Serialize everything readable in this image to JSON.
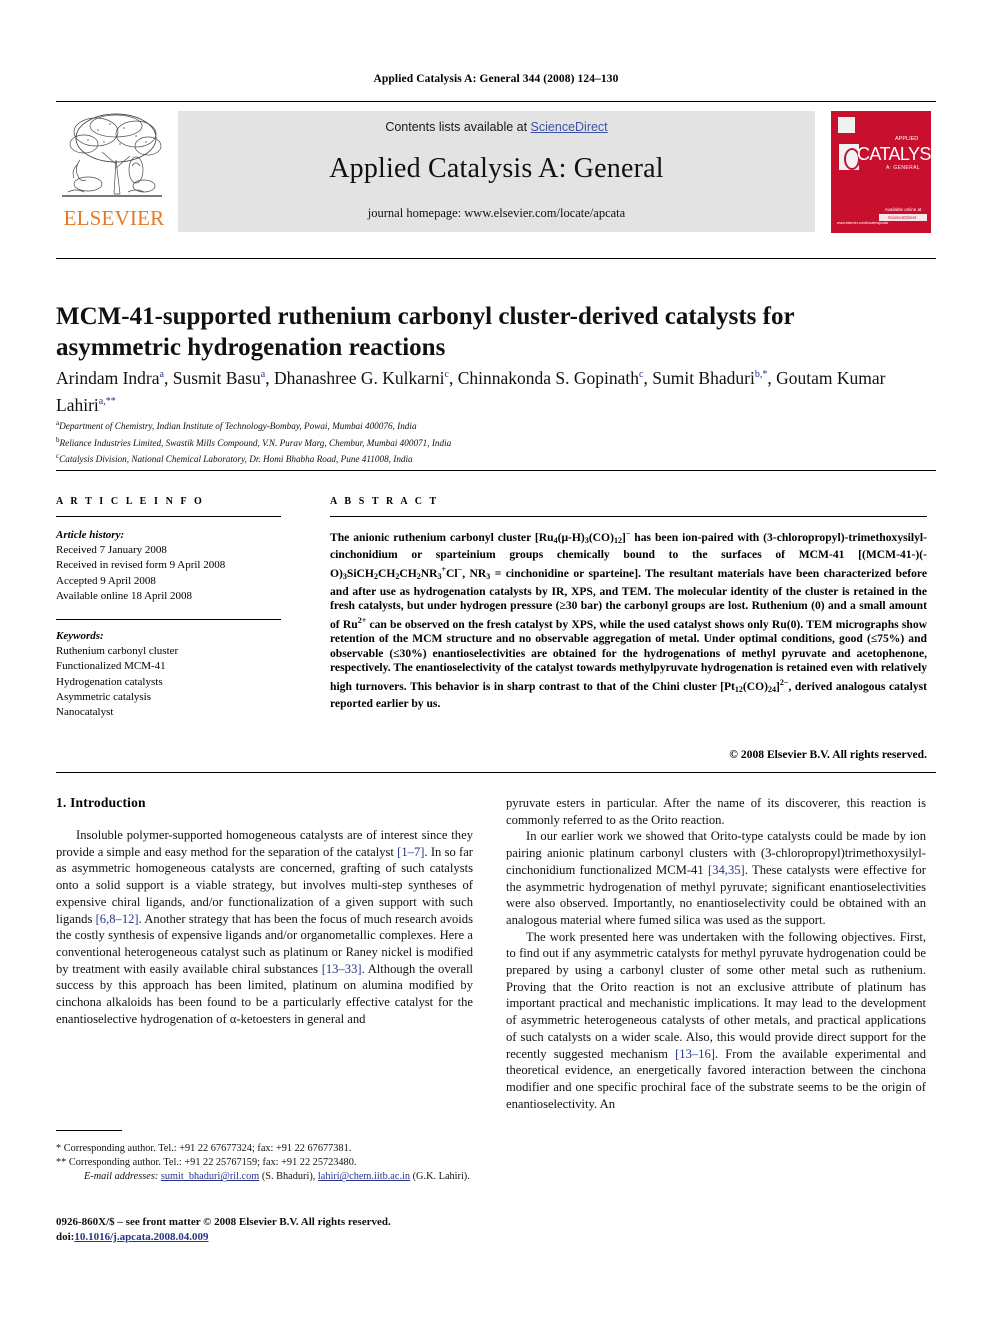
{
  "running_head": "Applied Catalysis A: General 344 (2008) 124–130",
  "masthead": {
    "contents_prefix": "Contents lists available at ",
    "sciencedirect": "ScienceDirect",
    "journal_title": "Applied Catalysis A: General",
    "journal_homepage": "journal homepage: www.elsevier.com/locate/apcata",
    "publisher_name": "ELSEVIER",
    "cover": {
      "catalysis": "CATALYSIS",
      "applied": "APPLIED",
      "general": "A: GENERAL",
      "sciencedirect_label": "Available online at",
      "sciencedirect_name": "ScienceDirect",
      "bottom_note": "www.elsevier.com/locate/apcata"
    },
    "accent_orange": "#E87722",
    "cover_red": "#C8102E",
    "link_blue": "#3a53a4"
  },
  "title": "MCM-41-supported ruthenium carbonyl cluster-derived catalysts for asymmetric hydrogenation reactions",
  "authors_html": "Arindam Indra<sup>a</sup>, Susmit Basu<sup>a</sup>, Dhanashree G. Kulkarni<sup>c</sup>, Chinnakonda S. Gopinath<sup>c</sup>, Sumit Bhaduri<sup>b,*</sup>, Goutam Kumar Lahiri<sup>a,**</sup>",
  "affiliations": [
    {
      "marker": "a",
      "text": "Department of Chemistry, Indian Institute of Technology-Bombay, Powai, Mumbai 400076, India"
    },
    {
      "marker": "b",
      "text": "Reliance Industries Limited, Swastik Mills Compound, V.N. Purav Marg, Chembur, Mumbai 400071, India"
    },
    {
      "marker": "c",
      "text": "Catalysis Division, National Chemical Laboratory, Dr. Homi Bhabha Road, Pune 411008, India"
    }
  ],
  "article_info": {
    "header": "A R T I C L E  I N F O",
    "history_label": "Article history:",
    "history": [
      "Received 7 January 2008",
      "Received in revised form 9 April 2008",
      "Accepted 9 April 2008",
      "Available online 18 April 2008"
    ],
    "keywords_label": "Keywords:",
    "keywords": [
      "Ruthenium carbonyl cluster",
      "Functionalized MCM-41",
      "Hydrogenation catalysts",
      "Asymmetric catalysis",
      "Nanocatalyst"
    ]
  },
  "abstract": {
    "header": "A B S T R A C T",
    "body_html": "The anionic ruthenium carbonyl cluster [Ru<sub>4</sub>(&mu;-H)<sub>3</sub>(CO)<sub>12</sub>]<sup>&minus;</sup> has been ion-paired with (3-chloropropyl)-trimethoxysilyl-cinchonidium or sparteinium groups chemically bound to the surfaces of MCM-41 [(MCM-41-)(-O)<sub>3</sub>SiCH<sub>2</sub>CH<sub>2</sub>CH<sub>2</sub>NR<sub>3</sub><sup>+</sup>Cl<sup>&minus;</sup>, NR<sub>3</sub>&nbsp;=&nbsp;cinchonidine or sparteine]. The resultant materials have been characterized before and after use as hydrogenation catalysts by IR, XPS, and TEM. The molecular identity of the cluster is retained in the fresh catalysts, but under hydrogen pressure (&ge;30 bar) the carbonyl groups are lost. Ruthenium (0) and a small amount of Ru<sup>2+</sup> can be observed on the fresh catalyst by XPS, while the used catalyst shows only Ru(0). TEM micrographs show retention of the MCM structure and no observable aggregation of metal. Under optimal conditions, good (&le;75%) and observable (&le;30%) enantioselectivities are obtained for the hydrogenations of methyl pyruvate and acetophenone, respectively. The enantioselectivity of the catalyst towards methylpyruvate hydrogenation is retained even with relatively high turnovers. This behavior is in sharp contrast to that of the Chini cluster [Pt<sub>12</sub>(CO)<sub>24</sub>]<sup>2&minus;</sup>, derived analogous catalyst reported earlier by us.",
    "copyright": "© 2008 Elsevier B.V. All rights reserved."
  },
  "body": {
    "section_heading": "1. Introduction",
    "left_paragraphs": [
      "Insoluble polymer-supported homogeneous catalysts are of interest since they provide a simple and easy method for the separation of the catalyst <span class=\"cite\">[1–7]</span>. In so far as asymmetric homogeneous catalysts are concerned, grafting of such catalysts onto a solid support is a viable strategy, but involves multi-step syntheses of expensive chiral ligands, and/or functionalization of a given support with such ligands <span class=\"cite\">[6,8–12]</span>. Another strategy that has been the focus of much research avoids the costly synthesis of expensive ligands and/or organometallic complexes. Here a conventional heterogeneous catalyst such as platinum or Raney nickel is modified by treatment with easily available chiral substances <span class=\"cite\">[13–33]</span>. Although the overall success by this approach has been limited, platinum on alumina modified by cinchona alkaloids has been found to be a particularly effective catalyst for the enantioselective hydrogenation of &alpha;-ketoesters in general and"
    ],
    "right_paragraphs": [
      "pyruvate esters in particular. After the name of its discoverer, this reaction is commonly referred to as the Orito reaction.",
      "In our earlier work we showed that Orito-type catalysts could be made by ion pairing anionic platinum carbonyl clusters with (3-chloropropyl)trimethoxysilyl-cinchonidium functionalized MCM-41 <span class=\"cite\">[34,35]</span>. These catalysts were effective for the asymmetric hydrogenation of methyl pyruvate; significant enantioselectivities were also observed. Importantly, no enantioselectivity could be obtained with an analogous material where fumed silica was used as the support.",
      "The work presented here was undertaken with the following objectives. First, to find out if any asymmetric catalysts for methyl pyruvate hydrogenation could be prepared by using a carbonyl cluster of some other metal such as ruthenium. Proving that the Orito reaction is not an exclusive attribute of platinum has important practical and mechanistic implications. It may lead to the development of asymmetric heterogeneous catalysts of other metals, and practical applications of such catalysts on a wider scale. Also, this would provide direct support for the recently suggested mechanism <span class=\"cite\">[13–16]</span>. From the available experimental and theoretical evidence, an energetically favored interaction between the cinchona modifier and one specific prochiral face of the substrate seems to be the origin of enantioselectivity. An"
    ]
  },
  "footnotes": {
    "corresponding_1": "Corresponding author. Tel.: +91 22 67677324; fax: +91 22 67677381.",
    "corresponding_2": "Corresponding author. Tel.: +91 22 25767159; fax: +91 22 25723480.",
    "email_label": "E-mail addresses:",
    "email_1": "sumit_bhaduri@ril.com",
    "email_1_owner": "(S. Bhaduri),",
    "email_2": "lahiri@chem.iitb.ac.in",
    "email_2_owner": "(G.K. Lahiri).",
    "star_1": "*",
    "star_2": "**"
  },
  "imprint": {
    "line1": "0926-860X/$ – see front matter © 2008 Elsevier B.V. All rights reserved.",
    "doi_prefix": "doi:",
    "doi": "10.1016/j.apcata.2008.04.009"
  }
}
